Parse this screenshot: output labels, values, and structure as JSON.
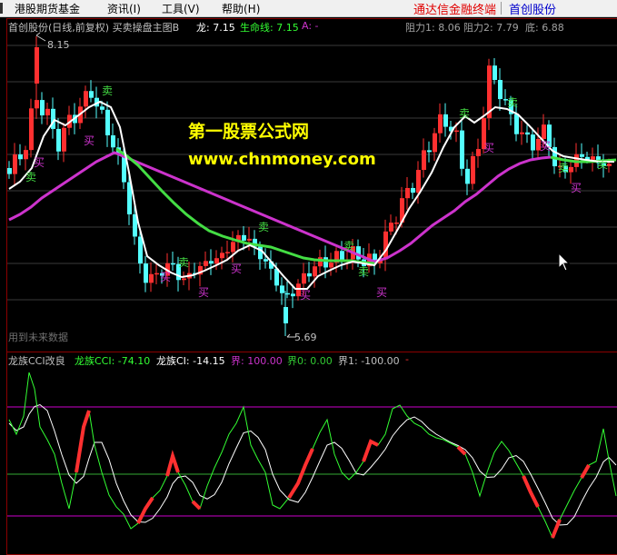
{
  "menubar": {
    "items": [
      "港股期货基金",
      "资讯(I)",
      "工具(V)",
      "帮助(H)"
    ],
    "brand": "通达信金融终端",
    "stock": "首创股份"
  },
  "main_panel": {
    "title": "首创股份(日线,前复权) 买卖操盘主图B",
    "long_label": "龙: 7.15",
    "life_label": "生命线: 7.15",
    "a_label": "A: -",
    "r1_label": "阻力1: 8.06",
    "r2_label": "阻力2: 7.79",
    "bottom_label": "底: 6.88",
    "high_label": "8.15",
    "low_label": "5.69",
    "future_note": "用到未来数据",
    "watermark_title": "第一股票公式网",
    "watermark_url": "www.chnmoney.com",
    "buy_marks": [
      "买",
      "买",
      "买",
      "买",
      "买",
      "买",
      "买",
      "买",
      "买",
      "买"
    ],
    "sell_marks": [
      "卖",
      "卖",
      "卖",
      "卖",
      "卖",
      "卖",
      "卖",
      "卖",
      "卖",
      "卖"
    ]
  },
  "cci_panel": {
    "title": "龙族CCI改良",
    "cci_label": "龙族CCI: -74.10",
    "ci_label": "龙族CI: -14.15",
    "upper_label": "界: 100.00",
    "zero_label": "界0: 0.00",
    "lower_label": "界1: -100.00",
    "dash_label": "-"
  },
  "colors": {
    "up": "#ff3030",
    "down": "#54ffff",
    "ma_white": "#ffffff",
    "life_green": "#44dd44",
    "long_magenta": "#cc33cc",
    "cci_green": "#33ff33",
    "band": "#cc00cc",
    "zero": "#33aa33"
  },
  "chart_data": {
    "type": "candlestick",
    "price_range": [
      5.69,
      8.15
    ],
    "cci_levels": [
      100,
      0,
      -100
    ]
  }
}
